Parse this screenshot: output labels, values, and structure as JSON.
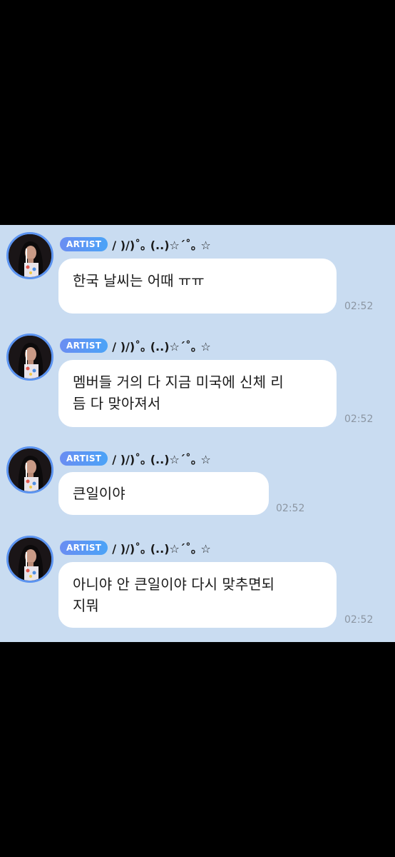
{
  "messages": [
    {
      "badge": "ARTIST",
      "sender": "/ )/)˚｡ (..)☆´˚｡ ☆",
      "lines": [
        "한국 날씨는 어때 ㅠㅠ"
      ],
      "time": "02:52"
    },
    {
      "badge": "ARTIST",
      "sender": "/ )/)˚｡ (..)☆´˚｡ ☆",
      "lines": [
        "멤버들 거의 다 지금 미국에 신체 리",
        "듬 다 맞아져서"
      ],
      "time": "02:52"
    },
    {
      "badge": "ARTIST",
      "sender": "/ )/)˚｡ (..)☆´˚｡ ☆",
      "lines": [
        "큰일이야"
      ],
      "time": "02:52"
    },
    {
      "badge": "ARTIST",
      "sender": "/ )/)˚｡ (..)☆´˚｡ ☆",
      "lines": [
        "아니야 안 큰일이야 다시 맞추면되",
        "지뭐"
      ],
      "time": "02:52"
    }
  ],
  "colors": {
    "background": "#c9dcf1",
    "bubble": "#ffffff",
    "badge": "#5b93f0",
    "timestamp": "#8c96a2"
  }
}
